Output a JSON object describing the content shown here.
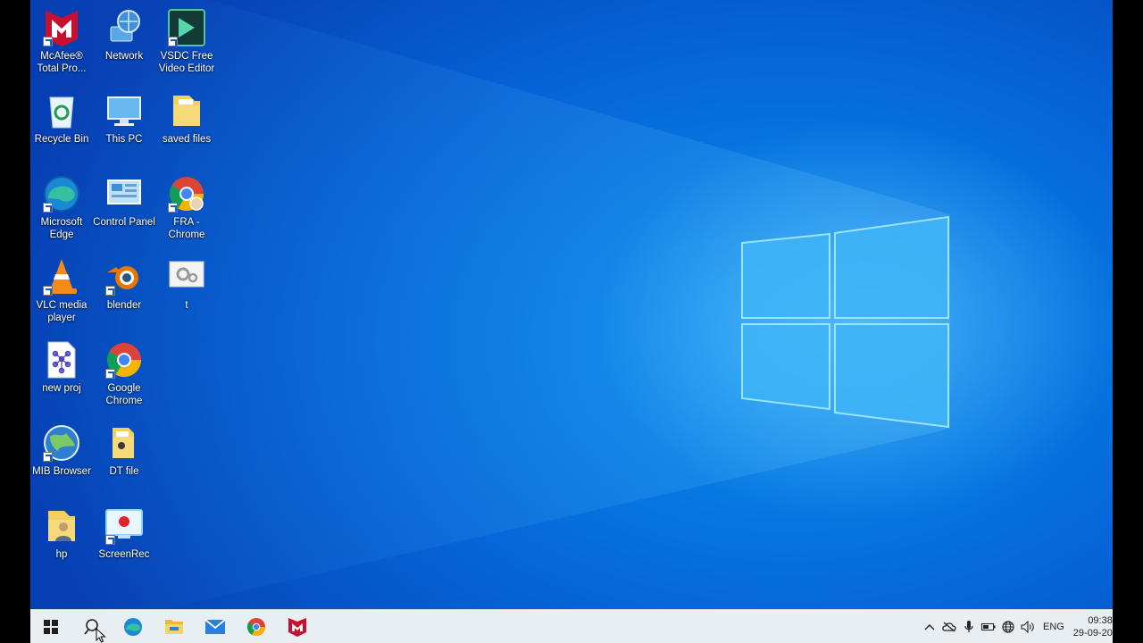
{
  "desktop": {
    "icons": [
      {
        "label": "McAfee® Total Pro...",
        "icon": "mcafee-icon"
      },
      {
        "label": "Network",
        "icon": "network-icon"
      },
      {
        "label": "VSDC Free Video Editor",
        "icon": "vsdc-icon"
      },
      {
        "label": "Recycle Bin",
        "icon": "recycle-bin-icon"
      },
      {
        "label": "This PC",
        "icon": "this-pc-icon"
      },
      {
        "label": "saved files",
        "icon": "folder-icon"
      },
      {
        "label": "Microsoft Edge",
        "icon": "edge-icon"
      },
      {
        "label": "Control Panel",
        "icon": "control-panel-icon"
      },
      {
        "label": "FRA - Chrome",
        "icon": "chrome-profile-icon"
      },
      {
        "label": "VLC media player",
        "icon": "vlc-icon"
      },
      {
        "label": "blender",
        "icon": "blender-icon"
      },
      {
        "label": "t",
        "icon": "settings-file-icon"
      },
      {
        "label": "new proj",
        "icon": "project-file-icon"
      },
      {
        "label": "Google Chrome",
        "icon": "chrome-icon"
      },
      {
        "label": "MIB Browser",
        "icon": "mib-browser-icon"
      },
      {
        "label": "DT file",
        "icon": "folder-icon"
      },
      {
        "label": "hp",
        "icon": "user-folder-icon"
      },
      {
        "label": "ScreenRec",
        "icon": "screenrec-icon"
      }
    ]
  },
  "taskbar": {
    "pinned": [
      "start-icon",
      "search-icon",
      "edge-icon",
      "file-explorer-icon",
      "mail-icon",
      "chrome-icon",
      "mcafee-icon"
    ],
    "tray_icons": [
      "chevron-up-icon",
      "onedrive-offline-icon",
      "microphone-icon",
      "battery-icon",
      "network-globe-icon",
      "volume-icon"
    ],
    "language": "ENG",
    "time": "09:38",
    "date": "29-09-20"
  },
  "colors": {
    "accent": "#0a78e6",
    "taskbar": "#e9eef3"
  }
}
